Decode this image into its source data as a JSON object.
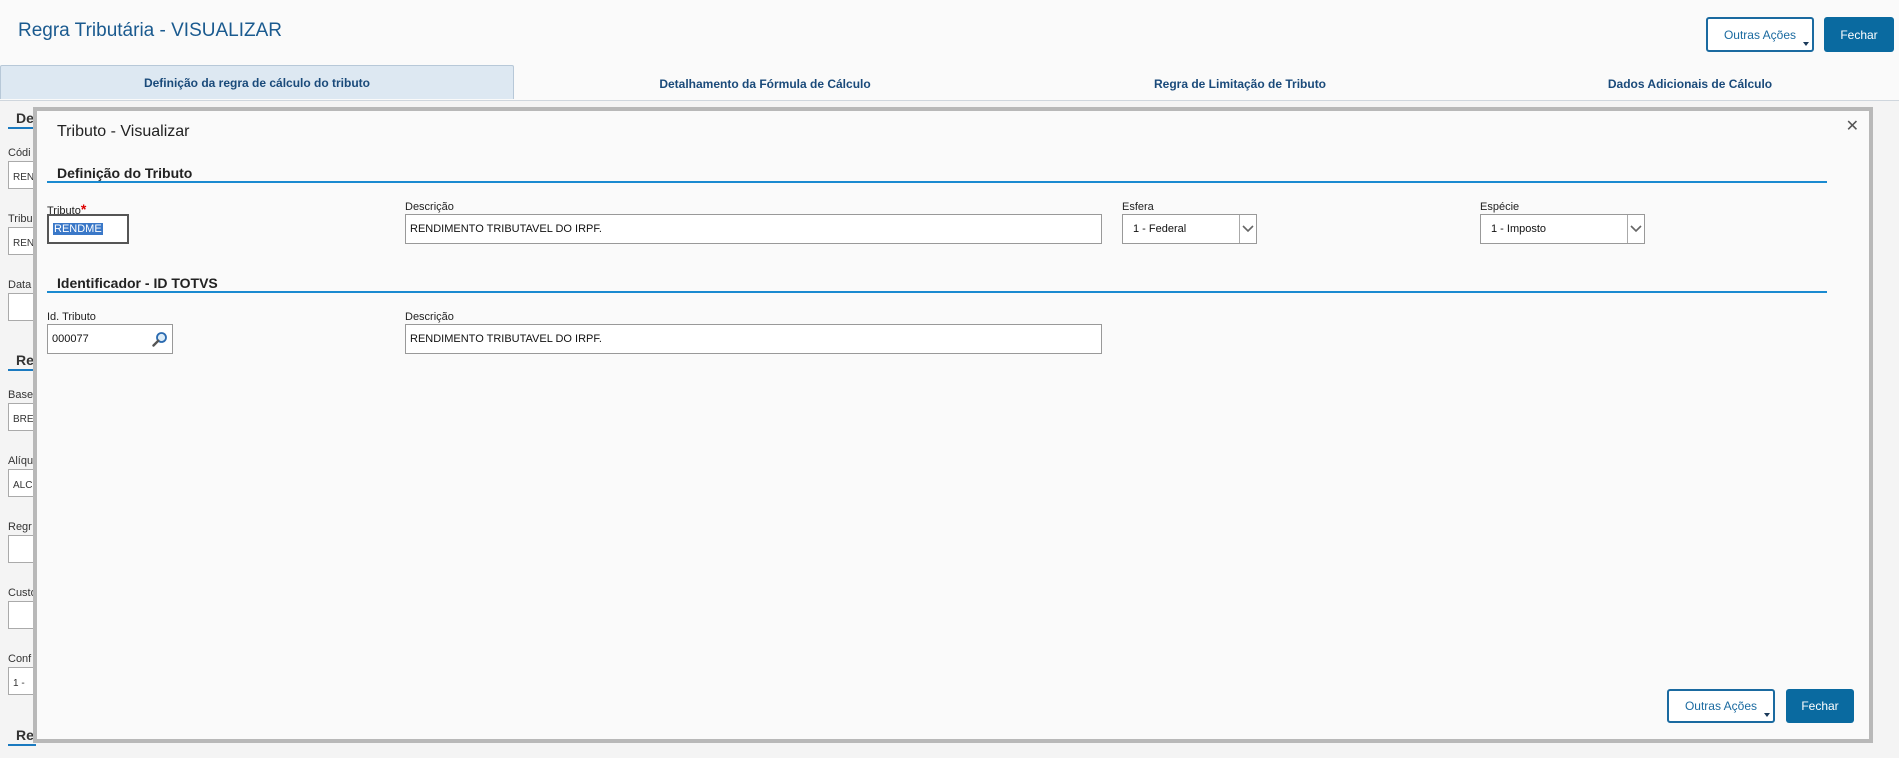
{
  "header": {
    "title": "Regra Tributária - VISUALIZAR",
    "other_actions_label": "Outras Ações",
    "close_label": "Fechar"
  },
  "tabs": [
    {
      "label": "Definição da regra de cálculo do tributo"
    },
    {
      "label": "Detalhamento da Fórmula de Cálculo"
    },
    {
      "label": "Regra de Limitação de Tributo"
    },
    {
      "label": "Dados Adicionais de Cálculo"
    }
  ],
  "background": {
    "section_1": "De",
    "label_1": "Códi",
    "value_1": "REN",
    "label_2": "Tribu",
    "value_2": "REN",
    "label_3": "Data",
    "section_2": "Re",
    "label_4": "Base",
    "value_4": "BRE",
    "label_5": "Alíqu",
    "value_5": "ALC",
    "label_6": "Regr",
    "label_7": "Custo",
    "label_8": "Conf",
    "value_8": "1 -",
    "section_3": "Re"
  },
  "modal": {
    "title": "Tributo - Visualizar",
    "section_tributo": "Definição do Tributo",
    "tributo_label": "Tributo",
    "tributo_value": "RENDME",
    "descricao_label": "Descrição",
    "descricao_value": "RENDIMENTO TRIBUTAVEL DO IRPF.",
    "esfera_label": "Esfera",
    "esfera_value": "1 - Federal",
    "especie_label": "Espécie",
    "especie_value": "1 - Imposto",
    "section_id": "Identificador - ID TOTVS",
    "id_label": "Id. Tributo",
    "id_value": "000077",
    "id_descricao_label": "Descrição",
    "id_descricao_value": "RENDIMENTO TRIBUTAVEL DO IRPF.",
    "other_actions_label": "Outras Ações",
    "close_label": "Fechar"
  },
  "colors": {
    "primary": "#0a6aa0",
    "accent_line": "#1a8ad0",
    "title_blue": "#1a5a8f"
  }
}
